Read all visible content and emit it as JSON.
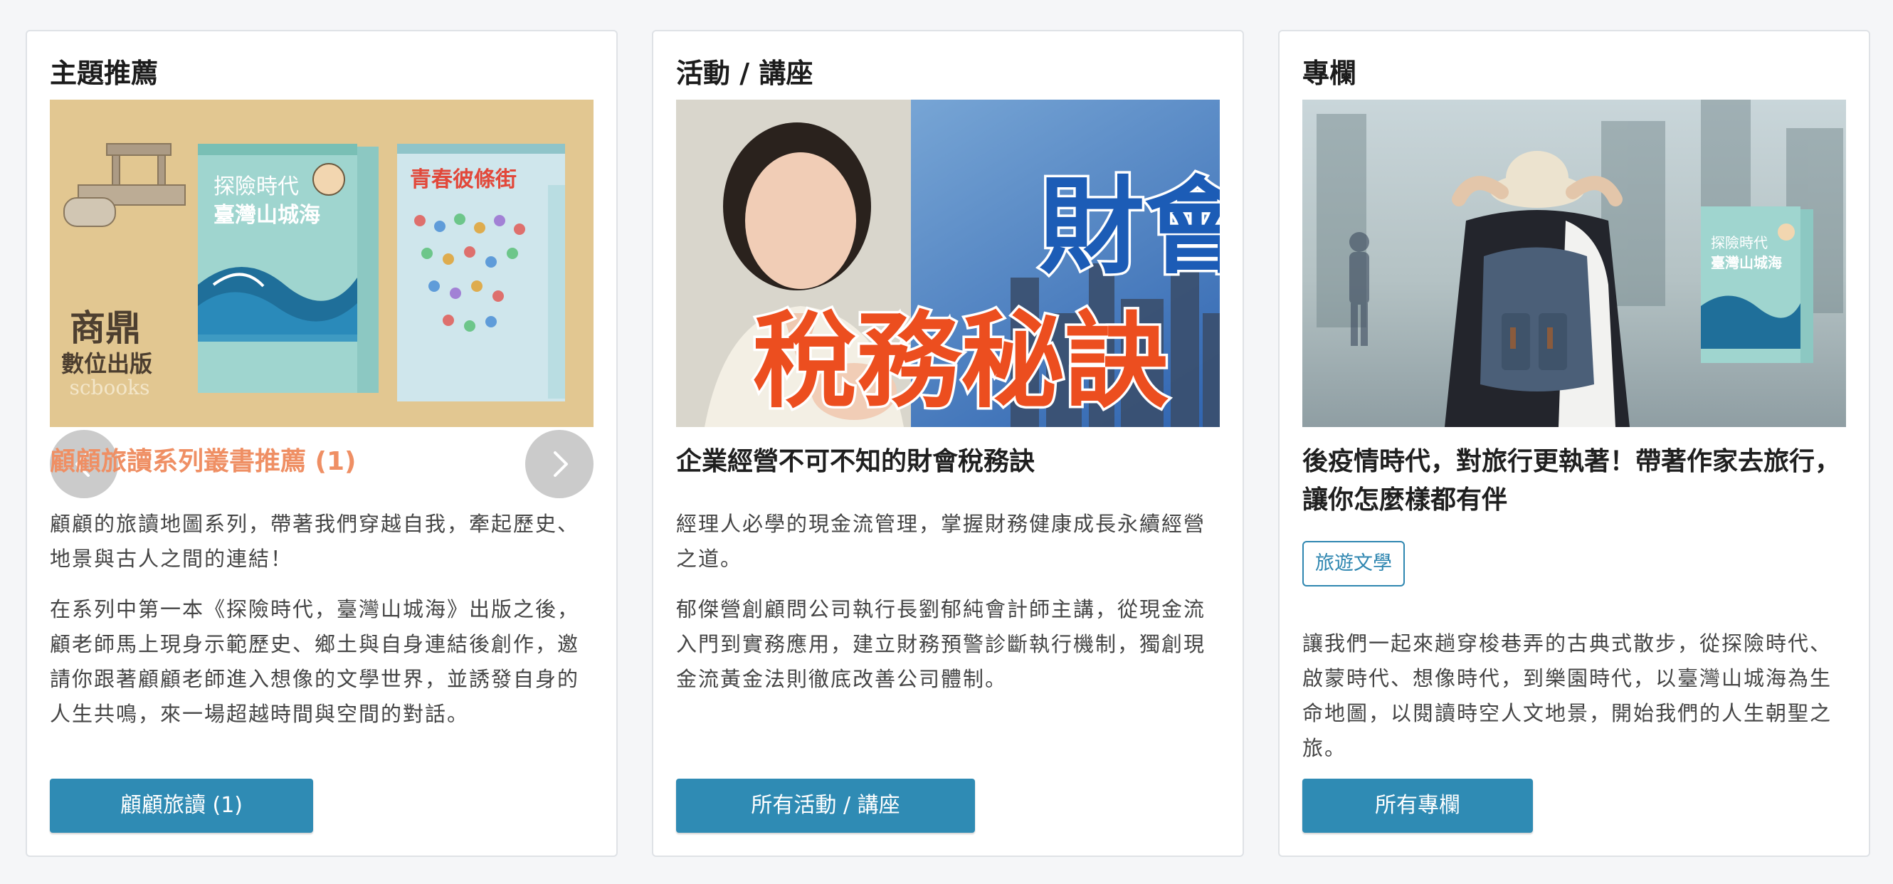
{
  "cards": [
    {
      "section_title": "主題推薦",
      "headline": "顧顧旅讀系列叢書推薦 (1)",
      "paragraphs": [
        "顧顧的旅讀地圖系列，帶著我們穿越自我，牽起歷史、地景與古人之間的連結！",
        "在系列中第一本《探險時代，臺灣山城海》出版之後，顧老師馬上現身示範歷史、鄉土與自身連結後創作，邀請你跟著顧顧老師進入想像的文學世界，並誘發自身的人生共鳴，來一場超越時間與空間的對話。"
      ],
      "button": "顧顧旅讀 (1)",
      "image": {
        "publisher_line1": "商鼎",
        "publisher_line2": "數位出版",
        "publisher_line3": "scbooks",
        "book1_title_line1": "探險時代",
        "book1_title_line2": "臺灣山城海",
        "book2_title": "青春彼條街"
      }
    },
    {
      "section_title": "活動 / 講座",
      "headline": "企業經營不可不知的財會稅務訣",
      "paragraphs": [
        "經理人必學的現金流管理，掌握財務健康成長永續經營之道。",
        "郁傑營創顧問公司執行長劉郁純會計師主講，從現金流入門到實務應用，建立財務預警診斷執行機制，獨創現金流黃金法則徹底改善公司體制。"
      ],
      "button": "所有活動 / 講座",
      "image": {
        "headline_line1": "財會",
        "headline_line2": "稅務秘訣"
      }
    },
    {
      "section_title": "專欄",
      "headline": "後疫情時代，對旅行更執著！帶著作家去旅行，讓你怎麼樣都有伴",
      "tag": "旅遊文學",
      "paragraphs": [
        "讓我們一起來趟穿梭巷弄的古典式散步，從探險時代、啟蒙時代、想像時代，到樂園時代，以臺灣山城海為生命地圖，以閱讀時空人文地景，開始我們的人生朝聖之旅。"
      ],
      "button": "所有專欄",
      "image": {
        "book_title_line1": "探險時代",
        "book_title_line2": "臺灣山城海"
      }
    }
  ],
  "icons": {
    "prev": "chevron-left-icon",
    "next": "chevron-right-icon"
  },
  "colors": {
    "accent_headline": "#ef8f64",
    "button_bg": "#2f8bb4",
    "tag_border": "#2e86b0"
  }
}
